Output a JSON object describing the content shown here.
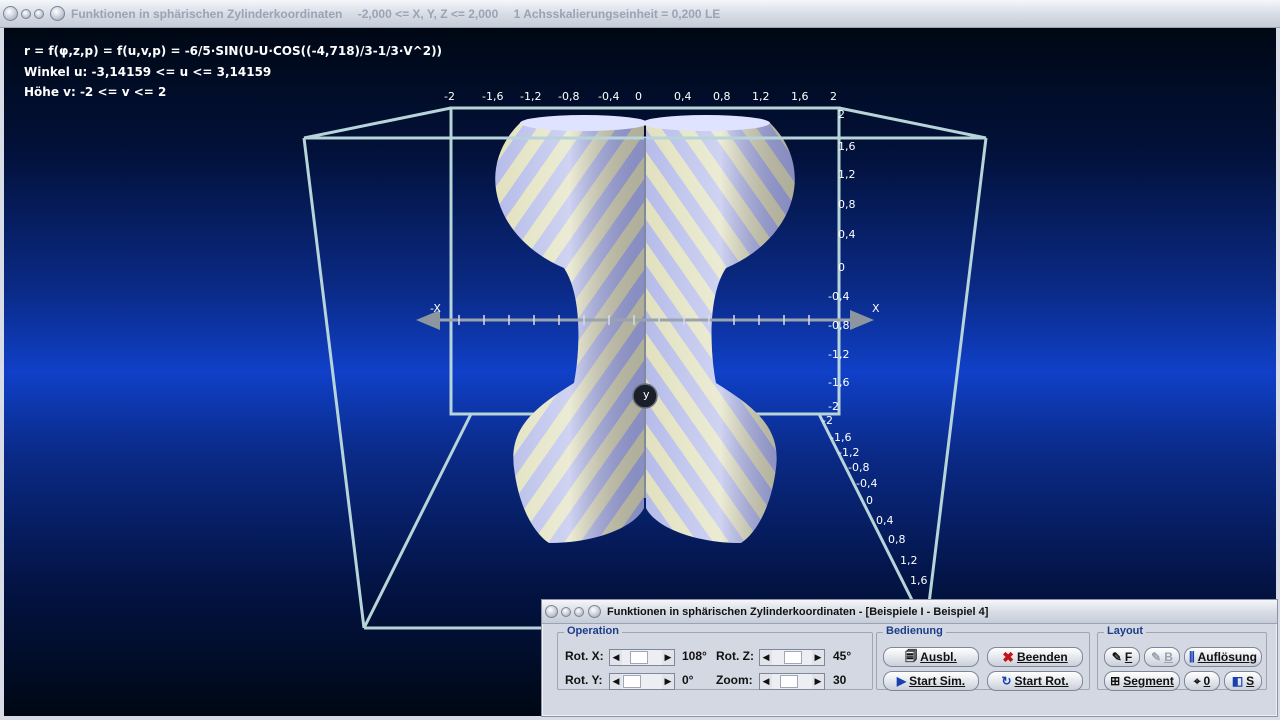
{
  "main_window": {
    "title": "Funktionen in sphärischen Zylinderkoordinaten",
    "range": "-2,000 <= X, Y, Z <= 2,000",
    "scale": "1 Achsskalierungseinheit = 0,200 LE"
  },
  "info": {
    "formula": "r = f(φ,z,p) = f(u,v,p) = -6/5·SIN(U-U·COS((-4,718)/3-1/3·V^2))",
    "angle": "Winkel u: -3,14159 <= u <= 3,14159",
    "height": "Höhe v: -2 <= v <= 2"
  },
  "axis_ticks": {
    "top": [
      "-2",
      "-1,6",
      "-1,2",
      "-0,8",
      "-0,4",
      "0",
      "0,4",
      "0,8",
      "1,2",
      "1,6",
      "2"
    ],
    "right": [
      "2",
      "1,6",
      "1,2",
      "0,8",
      "0,4",
      "0",
      "-0,4",
      "-0,8",
      "-1,2",
      "-1,6",
      "-2"
    ],
    "diagonal": [
      "-2",
      "-1,6",
      "-1,2",
      "-0,8",
      "-0,4",
      "0",
      "0,4",
      "0,8",
      "1,2",
      "1,6"
    ],
    "x_neg": "-X",
    "x_pos": "X",
    "y": "y"
  },
  "dialog": {
    "title": "Funktionen in sphärischen Zylinderkoordinaten - [Beispiele I - Beispiel 4]",
    "operation": {
      "label": "Operation",
      "rot_x_label": "Rot. X:",
      "rot_x_value": "108°",
      "rot_y_label": "Rot. Y:",
      "rot_y_value": "0°",
      "rot_z_label": "Rot. Z:",
      "rot_z_value": "45°",
      "zoom_label": "Zoom:",
      "zoom_value": "30"
    },
    "bedienung": {
      "label": "Bedienung",
      "ausbl": "Ausbl.",
      "beenden": "Beenden",
      "start_sim": "Start Sim.",
      "start_rot": "Start Rot."
    },
    "layout": {
      "label": "Layout",
      "f": "F",
      "b": "B",
      "aufloesung": "Auflösung",
      "segment": "Segment",
      "zero": "0",
      "s": "S"
    }
  },
  "colors": {
    "surface_light": "#eef0ff",
    "surface_stripe_blue": "#a9b0e6",
    "surface_stripe_yellow": "#dcdcb4",
    "frame": "#b7d4d8"
  }
}
